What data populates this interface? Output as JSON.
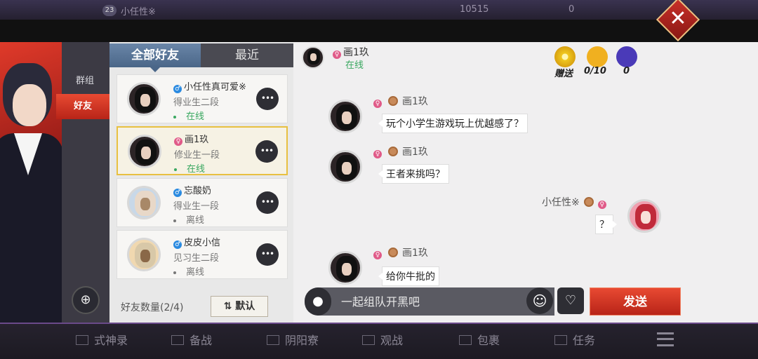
{
  "topbar": {
    "level": "23",
    "name": "小任性※",
    "coins": "10515",
    "jade": "0"
  },
  "sidebar": {
    "groups_tab": "群组",
    "friends_tab": "好友"
  },
  "friend_list": {
    "tab_all": "全部好友",
    "tab_recent": "最近",
    "friends": [
      {
        "name": "小任性真可爱※",
        "gender": "♂",
        "rank": "得业生二段",
        "status": "在线"
      },
      {
        "name": "画1玖",
        "gender": "♀",
        "rank": "修业生一段",
        "status": "在线"
      },
      {
        "name": "忘酸奶",
        "gender": "♂",
        "rank": "得业生一段",
        "status": "离线"
      },
      {
        "name": "皮皮小信",
        "gender": "♂",
        "rank": "见习生二段",
        "status": "离线"
      }
    ],
    "count_label": "好友数量(2/4)",
    "sort_label": "默认",
    "more_glyph": "•••"
  },
  "chat": {
    "partner_name": "画1玖",
    "partner_status": "在线",
    "gifts": {
      "send_label": "赠送",
      "received": "0/10",
      "other": "0"
    },
    "messages": [
      {
        "sender": "画1玖",
        "text": "玩个小学生游戏玩上优越感了？"
      },
      {
        "sender": "画1玖",
        "text": "王者来挑吗？"
      },
      {
        "sender": "小任性※",
        "text": "？"
      },
      {
        "sender": "画1玖",
        "text": "给你牛批的"
      }
    ],
    "input_placeholder": "一起组队开黑吧",
    "send_label": "发送"
  },
  "bottom_nav": [
    "式神录",
    "备战",
    "阴阳寮",
    "观战",
    "包裹",
    "任务"
  ],
  "icons": {
    "close": "close-icon",
    "mic": "mic-icon",
    "emoji": "emoji-icon",
    "sticker": "sticker-icon",
    "add_friend": "add-friend-icon",
    "menu": "menu-icon",
    "gender_male": "male-icon",
    "gender_female": "female-icon"
  },
  "colors": {
    "accent_red": "#d0301e",
    "online_green": "#3aa860",
    "male_blue": "#2a8ae0",
    "female_pink": "#e05a88",
    "selected_border": "#e8c040"
  }
}
